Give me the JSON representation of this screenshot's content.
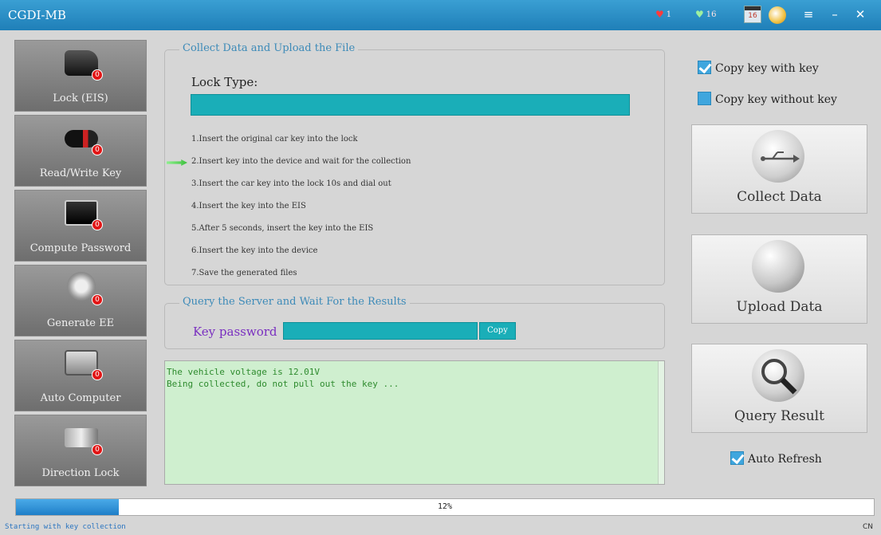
{
  "window": {
    "title": "CGDI-MB",
    "status_hearts": "1",
    "status_shields": "16",
    "calendar": "16"
  },
  "sidebar": {
    "items": [
      {
        "label": "Lock (EIS)",
        "badge": "0"
      },
      {
        "label": "Read/Write Key",
        "badge": "0"
      },
      {
        "label": "Compute Password",
        "badge": "0"
      },
      {
        "label": "Generate EE",
        "badge": "0"
      },
      {
        "label": "Auto Computer",
        "badge": "0"
      },
      {
        "label": "Direction Lock",
        "badge": "0"
      }
    ]
  },
  "collect": {
    "title": "Collect Data and Upload the File",
    "lock_type_label": "Lock Type:",
    "lock_type_value": "",
    "current_step": 2,
    "steps": [
      "1.Insert  the  original  car  key  into  the  lock",
      "2.Insert  key  into  the  device  and  wait  for  the  collection",
      "3.Insert  the  car  key  into  the  lock  10s  and  dial  out",
      "4.Insert  the  key  into  the  EIS",
      "5.After  5  seconds,  insert  the  key  into  the  EIS",
      "6.Insert  the  key  into  the  device",
      "7.Save  the  generated  files"
    ]
  },
  "query": {
    "title": "Query the Server and Wait For the Results",
    "key_password_label": "Key password",
    "key_password_value": "",
    "copy_label": "Copy"
  },
  "log": {
    "lines": [
      "The vehicle voltage is 12.01V",
      "Being collected, do not pull out the key ..."
    ]
  },
  "options": {
    "copy_with_key": {
      "label": "Copy key with key",
      "checked": true
    },
    "copy_without_key": {
      "label": "Copy key without key",
      "checked": false
    },
    "auto_refresh": {
      "label": "Auto Refresh",
      "checked": true
    }
  },
  "actions": {
    "collect_data": "Collect Data",
    "upload_data": "Upload  Data",
    "query_result": "Query Result"
  },
  "progress": {
    "percent": 12,
    "label": "12%"
  },
  "status": {
    "message": "Starting with key collection",
    "language": "CN"
  },
  "colors": {
    "titlebar": "#2a8fc8",
    "accent_teal": "#1aaeb8",
    "check_blue": "#3fa6de",
    "log_bg": "#cfefcf",
    "badge_red": "#e21515"
  }
}
